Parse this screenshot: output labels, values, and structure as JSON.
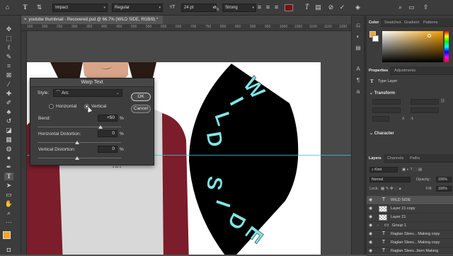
{
  "options_bar": {
    "font_family": "Impact",
    "font_style": "Regular",
    "font_size": "24 pt",
    "antialias": "Strong",
    "text_color": "#7a1010"
  },
  "document_tab": {
    "title": "youtube thumbnail - Recovered.psd @ 66.7% (WILD SIDE, RGB/8) *"
  },
  "ruler": {
    "ticks": [
      "150",
      "200",
      "250",
      "300",
      "350",
      "400",
      "450",
      "500",
      "550",
      "600",
      "650",
      "700",
      "750",
      "800",
      "850",
      "900",
      "950",
      "1000",
      "1050",
      "1100",
      "1150",
      "1200",
      "1250"
    ]
  },
  "warp_dialog": {
    "title": "Warp Text",
    "style_label": "Style:",
    "style_value": "Arc",
    "horizontal_label": "Horizontal",
    "vertical_label": "Vertical",
    "orientation_selected": "Vertical",
    "bend_label": "Bend:",
    "bend_value": "+50",
    "bend_level": 0.75,
    "hdist_label": "Horizontal Distortion:",
    "hdist_value": "0",
    "vdist_label": "Vertical Distortion:",
    "vdist_value": "0",
    "percent": "%",
    "ok_label": "OK",
    "cancel_label": "Cancel"
  },
  "canvas": {
    "warped_text": "WILD SIDE",
    "warped_text_color": "#7fe6e6",
    "shape_color": "#000000",
    "guide_color": "#3ec4d6"
  },
  "color_panel": {
    "tabs": [
      "Color",
      "Swatches",
      "Gradient",
      "Patterns"
    ],
    "foreground": "#f5a623"
  },
  "properties_panel": {
    "tabs": [
      "Properties",
      "Adjustments"
    ],
    "type_layer_label": "Type Layer",
    "transform_label": "Transform",
    "character_label": "Character"
  },
  "layers_panel": {
    "tabs": [
      "Layers",
      "Channels",
      "Paths"
    ],
    "kind_placeholder": "Kind",
    "blend_mode": "Normal",
    "opacity_label": "Opacity:",
    "opacity_value": "100%",
    "lock_label": "Lock:",
    "fill_label": "Fill:",
    "fill_value": "100%",
    "layers": [
      {
        "name": "WILD SIDE",
        "type": "text",
        "selected": true
      },
      {
        "name": "Layer 21 copy",
        "type": "pixel",
        "selected": false
      },
      {
        "name": "Layer 21",
        "type": "pixel",
        "selected": false
      },
      {
        "name": "Group 1",
        "type": "group",
        "selected": false
      },
      {
        "name": "Raglan Sleev... Making copy",
        "type": "text",
        "selected": false
      },
      {
        "name": "Raglan Sleev... Making copy",
        "type": "text",
        "selected": false
      },
      {
        "name": "Raglan Sleev...ttern Making",
        "type": "text",
        "selected": false
      }
    ]
  }
}
